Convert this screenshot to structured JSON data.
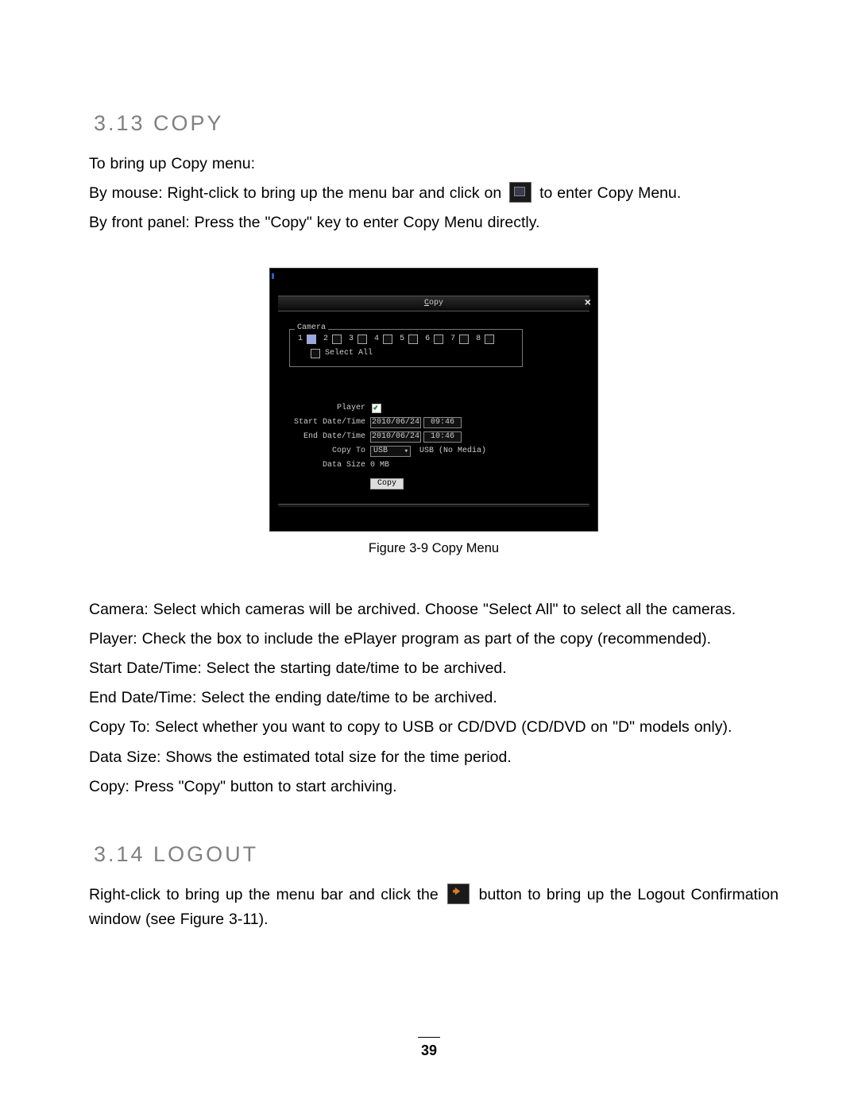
{
  "section_copy": {
    "heading": "3.13 COPY",
    "line1": "To bring up Copy menu:",
    "line2a": "By mouse: Right-click to bring up the menu bar and click on ",
    "line2b": " to enter Copy Menu.",
    "line3": "By front panel: Press the \"Copy\" key to enter Copy Menu directly.",
    "caption": "Figure 3-9 Copy Menu",
    "defs": {
      "camera": "Camera: Select which cameras will be archived. Choose \"Select All\" to select all the cameras.",
      "player": "Player: Check the box to include the ePlayer program as part of the copy (recommended).",
      "start": "Start Date/Time: Select the starting date/time to be archived.",
      "end": "End Date/Time: Select the ending date/time to be archived.",
      "copyto": "Copy To: Select whether you want to copy to USB or CD/DVD (CD/DVD on \"D\" models only).",
      "size": "Data Size: Shows the estimated total size for the time period.",
      "copy": "Copy: Press \"Copy\" button to start archiving."
    }
  },
  "section_logout": {
    "heading": "3.14 LOGOUT",
    "line1a": "Right-click to bring up the menu bar and click the ",
    "line1b": " button to bring up the Logout Confirmation window (see Figure 3-11)."
  },
  "copy_window": {
    "title_underlined": "C",
    "title_rest": "opy",
    "legend": "Camera",
    "cameras": [
      "1",
      "2",
      "3",
      "4",
      "5",
      "6",
      "7",
      "8"
    ],
    "select_all": "Select All",
    "player_label": "Player",
    "start_label": "Start Date/Time",
    "start_date": "2010/06/24",
    "start_time": "09:46",
    "end_label": "End Date/Time",
    "end_date": "2010/06/24",
    "end_time": "10:46",
    "copyto_label": "Copy To",
    "copyto_value": "USB",
    "copyto_status": "USB (No Media)",
    "size_label": "Data Size",
    "size_value": "0 MB",
    "copy_btn": "Copy"
  },
  "page_number": "39"
}
